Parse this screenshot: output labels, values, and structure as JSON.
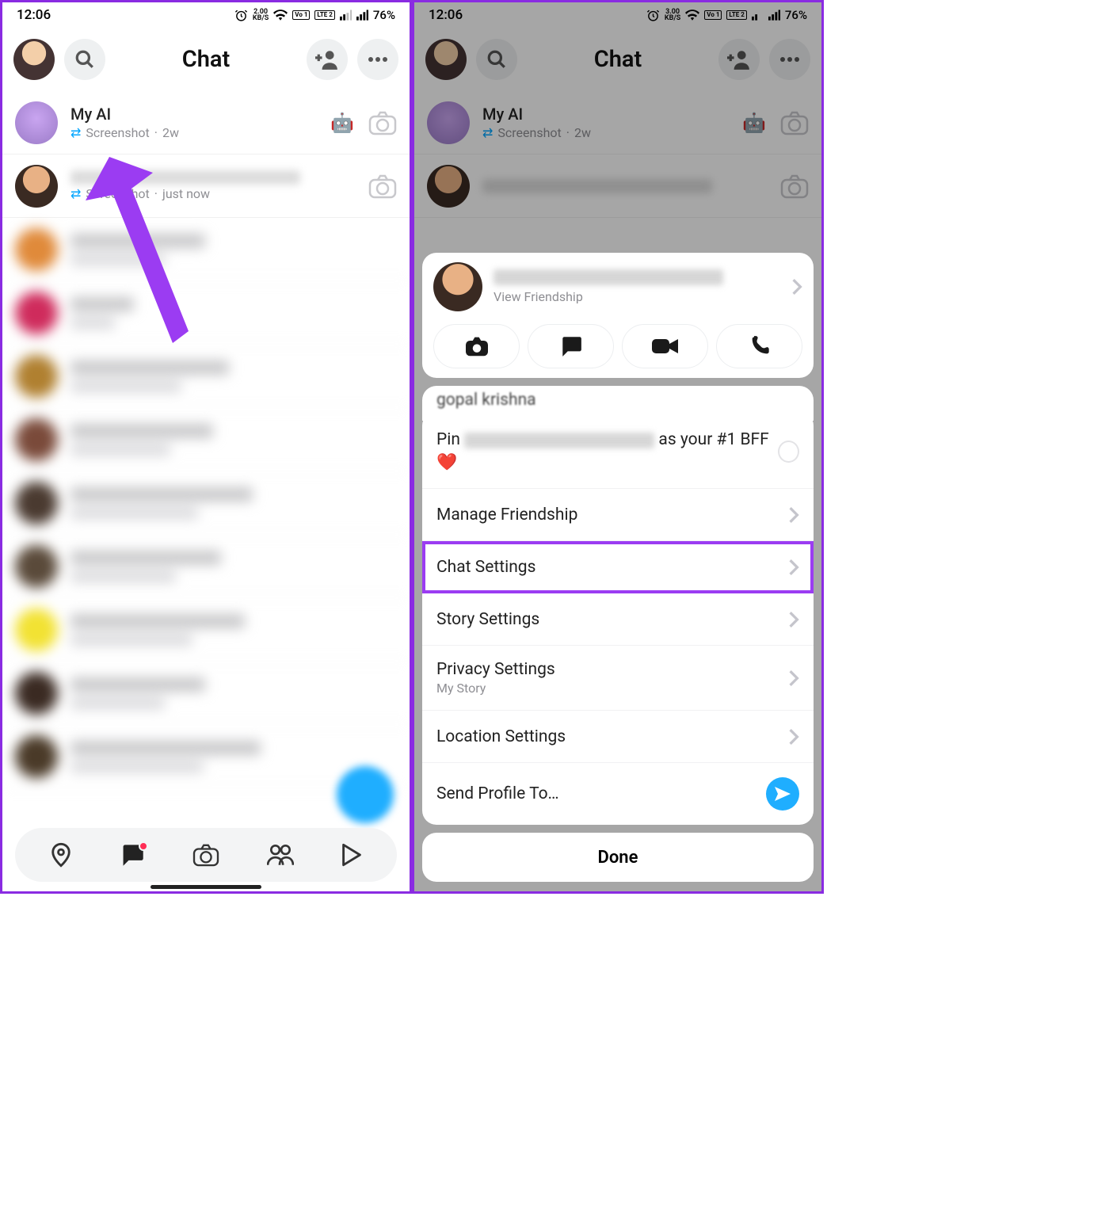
{
  "status": {
    "time": "12:06",
    "data_rate_top": "2.00",
    "data_rate_top_right": "3.00",
    "data_rate_unit": "KB/S",
    "lte": "LTE 2",
    "vo": "Vo 1",
    "battery": "76%"
  },
  "header": {
    "title": "Chat"
  },
  "chats": {
    "ai": {
      "name": "My AI",
      "sub": "Screenshot",
      "time": "2w"
    },
    "friend": {
      "sub": "Screenshot",
      "time": "just now"
    }
  },
  "blurred_colors": [
    "#e08a3a",
    "#cf2b5c",
    "#b08030",
    "#7a4a3a",
    "#4a3a30",
    "#5a4a3a",
    "#f2e233",
    "#3a2a22",
    "#4a3a28"
  ],
  "sheet": {
    "view_friendship": "View Friendship",
    "peek_name": "gopal krishna",
    "pin_prefix": "Pin",
    "pin_suffix": "as your #1 BFF ❤️",
    "manage": "Manage Friendship",
    "chat_settings": "Chat Settings",
    "story_settings": "Story Settings",
    "privacy_settings": "Privacy Settings",
    "privacy_sub": "My Story",
    "location_settings": "Location Settings",
    "send_profile": "Send Profile To…",
    "done": "Done"
  }
}
